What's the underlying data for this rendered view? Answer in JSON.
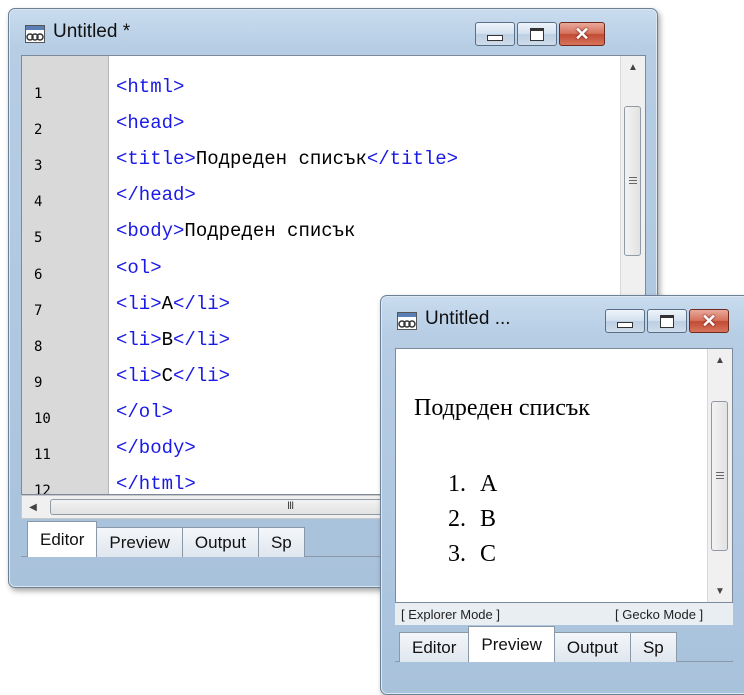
{
  "editor_window": {
    "title": "Untitled *",
    "icon": "app-icon",
    "lines": [
      {
        "num": "1",
        "tag": "<html>",
        "text": ""
      },
      {
        "num": "2",
        "tag": "<head>",
        "text": ""
      },
      {
        "num": "3",
        "tag": "<title>",
        "text": "Подреден списък",
        "tag_end": "</title>"
      },
      {
        "num": "4",
        "tag": "</head>",
        "text": ""
      },
      {
        "num": "5",
        "tag": "<body>",
        "text": "Подреден списък"
      },
      {
        "num": "6",
        "tag": "<ol>",
        "text": ""
      },
      {
        "num": "7",
        "tag": "<li>",
        "text": "A",
        "tag_end": "</li>"
      },
      {
        "num": "8",
        "tag": "<li>",
        "text": "B",
        "tag_end": "</li>"
      },
      {
        "num": "9",
        "tag": "<li>",
        "text": "C",
        "tag_end": "</li>"
      },
      {
        "num": "10",
        "tag": "</ol>",
        "text": ""
      },
      {
        "num": "11",
        "tag": "</body>",
        "text": ""
      },
      {
        "num": "12",
        "tag": "</html>",
        "text": ""
      }
    ],
    "scroll_thumb_grip": "III",
    "tabs": [
      "Editor",
      "Preview",
      "Output",
      "Sp"
    ],
    "active_tab": "Editor"
  },
  "preview_window": {
    "title": "Untitled ...",
    "heading": "Подреден списък",
    "list_items": [
      {
        "marker": "1.",
        "text": "A"
      },
      {
        "marker": "2.",
        "text": "B"
      },
      {
        "marker": "3.",
        "text": "C"
      }
    ],
    "modes": [
      "[ Explorer Mode ]",
      "[ Gecko Mode ]"
    ],
    "tabs": [
      "Editor",
      "Preview",
      "Output",
      "Sp"
    ],
    "active_tab": "Preview"
  },
  "colors": {
    "tag": "#1a1ae6",
    "close_button": "#c24b33",
    "frame": "#b6cde4"
  }
}
